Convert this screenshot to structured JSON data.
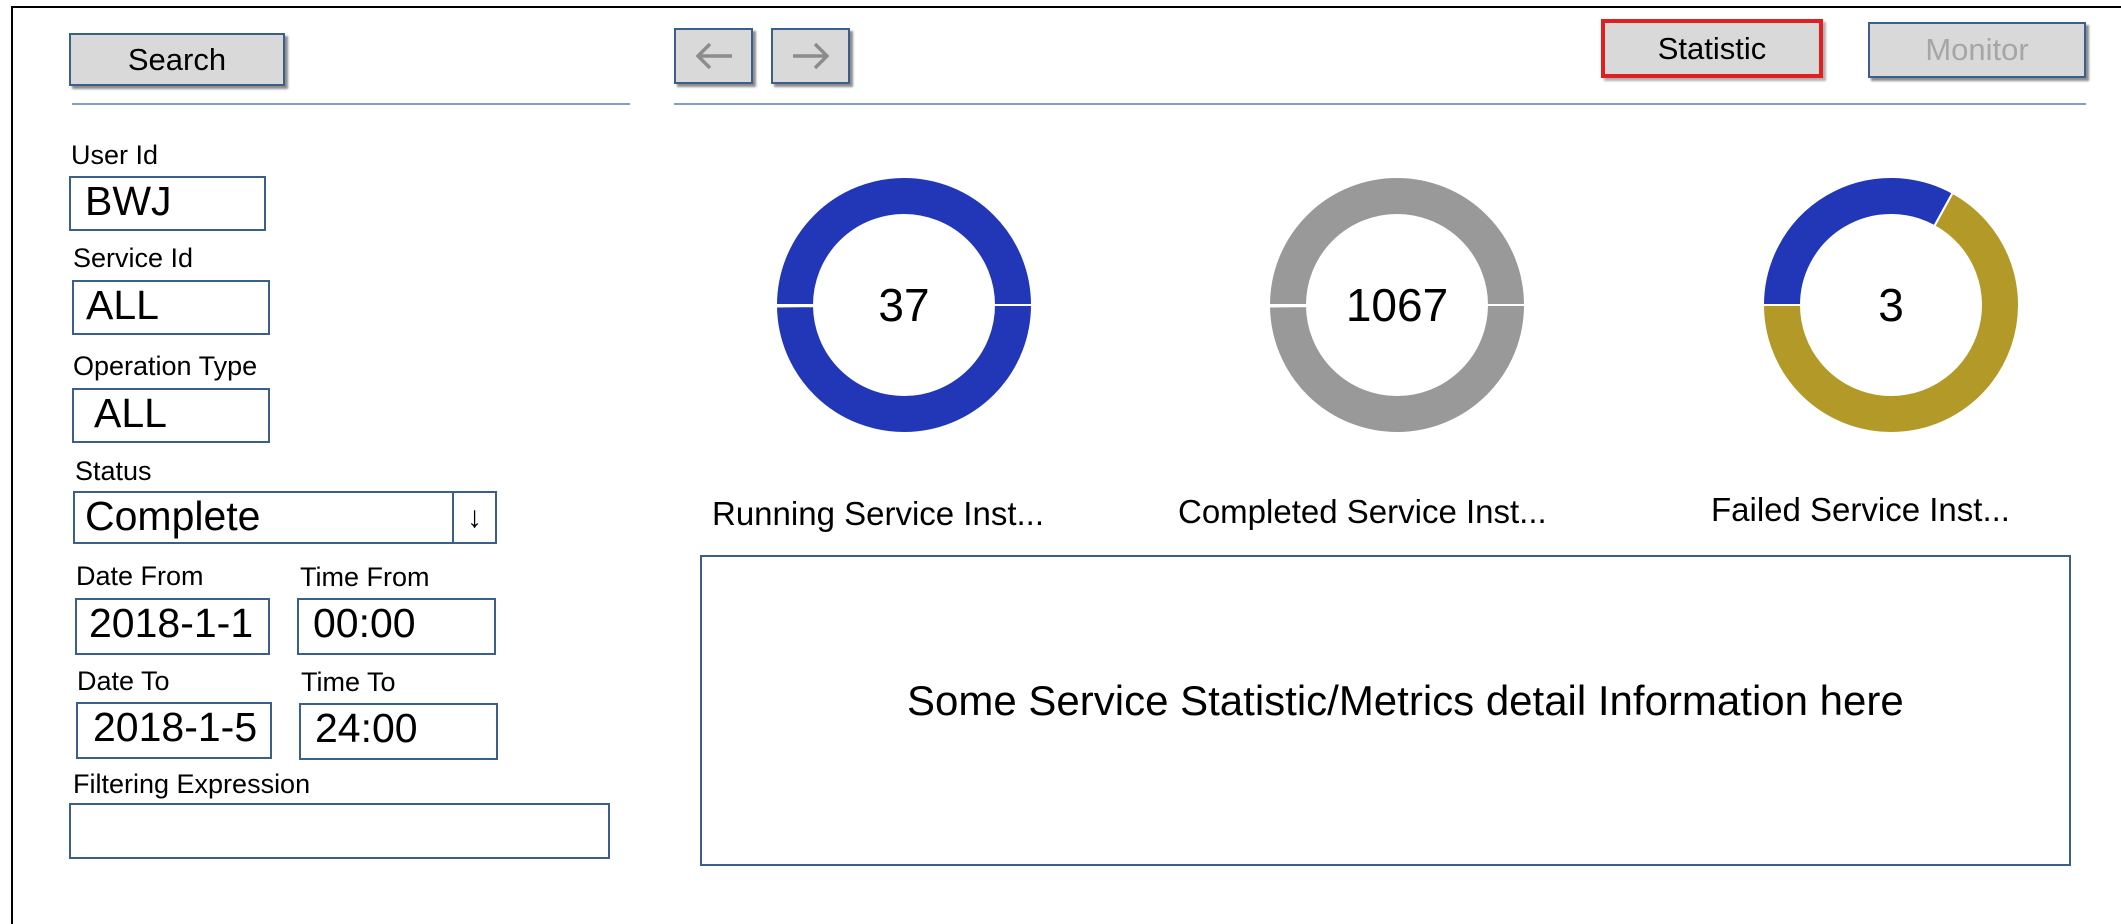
{
  "toolbar": {
    "search_label": "Search",
    "statistic_label": "Statistic",
    "monitor_label": "Monitor",
    "back_icon": "arrow-left",
    "forward_icon": "arrow-right"
  },
  "filters": {
    "user_id": {
      "label": "User Id",
      "value": "BWJ"
    },
    "service_id": {
      "label": "Service Id",
      "value": "ALL"
    },
    "operation_type": {
      "label": "Operation Type",
      "value": "ALL"
    },
    "status": {
      "label": "Status",
      "value": "Complete",
      "arrow": "↓"
    },
    "date_from": {
      "label": "Date From",
      "value": "2018-1-1"
    },
    "time_from": {
      "label": "Time From",
      "value": "00:00"
    },
    "date_to": {
      "label": "Date To",
      "value": "2018-1-5"
    },
    "time_to": {
      "label": "Time To",
      "value": "24:00"
    },
    "filter_expression": {
      "label": "Filtering Expression",
      "value": ""
    }
  },
  "chart_data": [
    {
      "type": "pie",
      "title": "Running Service Inst...",
      "center_label": "37",
      "slices": [
        {
          "value": 1.0,
          "color": "#2236b8"
        }
      ]
    },
    {
      "type": "pie",
      "title": "Completed Service Inst...",
      "center_label": "1067",
      "slices": [
        {
          "value": 1.0,
          "color": "#999999"
        }
      ]
    },
    {
      "type": "pie",
      "title": "Failed Service Inst...",
      "center_label": "3",
      "slices": [
        {
          "value": 0.33,
          "color": "#2236b8"
        },
        {
          "value": 0.67,
          "color": "#b39a28"
        }
      ]
    }
  ],
  "detail": {
    "text": "Some Service Statistic/Metrics detail Information here"
  },
  "colors": {
    "statistic_border": "#e02020",
    "monitor_text": "#a6a6a6"
  }
}
